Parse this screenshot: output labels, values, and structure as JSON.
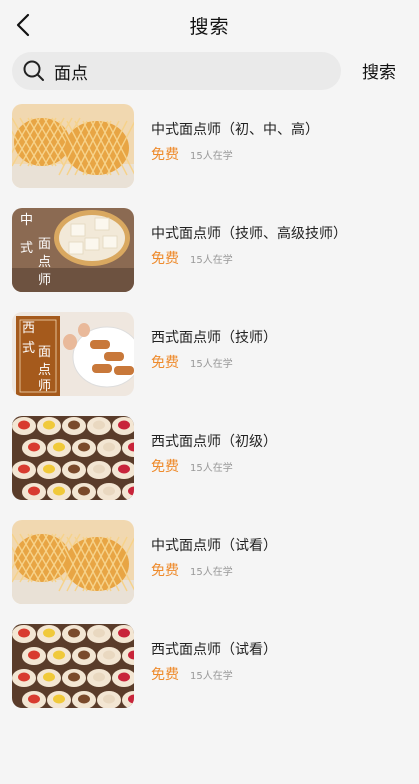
{
  "header": {
    "title": "搜索",
    "back_icon": "chevron-left-icon"
  },
  "search": {
    "value": "面点",
    "button_label": "搜索",
    "icon": "search-icon"
  },
  "courses": [
    {
      "title": "中式面点师（初、中、高）",
      "price": "免费",
      "learners": "15人在学",
      "thumb": "pineapple-bun"
    },
    {
      "title": "中式面点师（技师、高级技师）",
      "price": "免费",
      "learners": "15人在学",
      "thumb": "chinese-pastry",
      "thumb_text": [
        "中",
        "式",
        "面",
        "点",
        "师"
      ]
    },
    {
      "title": "西式面点师（技师）",
      "price": "免费",
      "learners": "15人在学",
      "thumb": "western-pastry",
      "thumb_text": [
        "西",
        "式",
        "面",
        "点",
        "师"
      ]
    },
    {
      "title": "西式面点师（初级）",
      "price": "免费",
      "learners": "15人在学",
      "thumb": "cookies"
    },
    {
      "title": "中式面点师（试看）",
      "price": "免费",
      "learners": "15人在学",
      "thumb": "pineapple-bun"
    },
    {
      "title": "西式面点师（试看）",
      "price": "免费",
      "learners": "15人在学",
      "thumb": "cookies"
    }
  ],
  "colors": {
    "price": "#ee8a2b",
    "background": "#f5f5f5",
    "search_bg": "#eaeaea"
  }
}
